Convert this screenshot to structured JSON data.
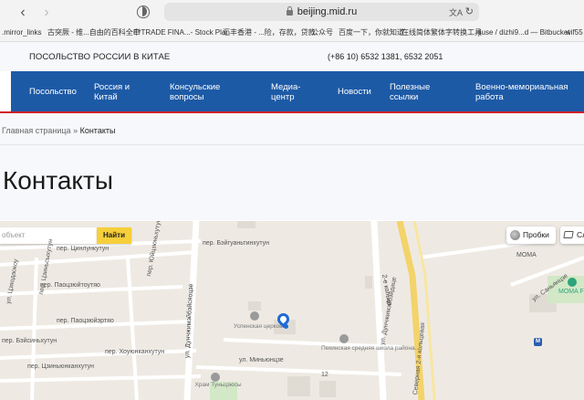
{
  "browser": {
    "url": "beijing.mid.ru",
    "bookmarks": [
      ".mirror_links",
      "古突厥 - 维...自由的百科全书",
      "E*TRADE FINA...- Stock Plan",
      "汇丰香港 - ...险，存款，贷款",
      "公众号",
      "百度一下，你就知道",
      "在线简体繁体字转换工具",
      "jiuse / dizhi9...d — Bitbucket",
      "wif55"
    ]
  },
  "site": {
    "name": "ПОСОЛЬСТВО РОССИИ В КИТАЕ",
    "phone": "(+86 10) 6532 1381, 6532 2051",
    "nav": [
      {
        "line1": "Посольство",
        "line2": ""
      },
      {
        "line1": "Россия и",
        "line2": "Китай"
      },
      {
        "line1": "Консульские",
        "line2": "вопросы"
      },
      {
        "line1": "Медиа-",
        "line2": "центр"
      },
      {
        "line1": "Новости",
        "line2": ""
      },
      {
        "line1": "Полезные",
        "line2": "ссылки"
      },
      {
        "line1": "Военно-мемориальная",
        "line2": "работа"
      }
    ],
    "colors": {
      "nav_bg": "#1d5aa6",
      "accent_line": "#d0202a"
    }
  },
  "breadcrumb": {
    "home": "Главная страница",
    "separator": "»",
    "current": "Контакты"
  },
  "page_title": "Контакты",
  "map": {
    "search_placeholder": "объект",
    "search_button": "Найти",
    "traffic_button": "Пробки",
    "layers_button": "Сл",
    "labels": {
      "street1": "пер. Цинлункутун",
      "street2": "пер. Бэйгуаньтинхутун",
      "street3": "пер. Паоцзюйтоутяо",
      "street4": "пер. Юйцзюньхутун",
      "street5": "пер. Цзиньсыхутун",
      "street6": "пер. Паоцзюйэртяо",
      "street7": "ул. Цзяодаокоу",
      "street8": "пер. Хоуюнканхутун",
      "street9": "пер. Бэйсиньхутун",
      "street10": "пер. Цзиньюнканхутун",
      "street11": "ул. Дунчжимэйбэйсяоцзе",
      "street12": "ул. Дунчжимэйбэйсяоцзе",
      "street13": "ул. Миньюнцзе",
      "street14": "2-е кольцо",
      "street15": "ул. Дунчжимэйбэйдаце",
      "street16": "Северная 2-я кольцевая",
      "street17": "ул. Саньянцзе",
      "poi1": "Успенская церковь",
      "poi2": "Пекинская средняя школа района...",
      "poi3": "Храм Туньцзюсы",
      "poi4": "MOMA",
      "poi5": "MOMA F",
      "number": "12"
    }
  }
}
